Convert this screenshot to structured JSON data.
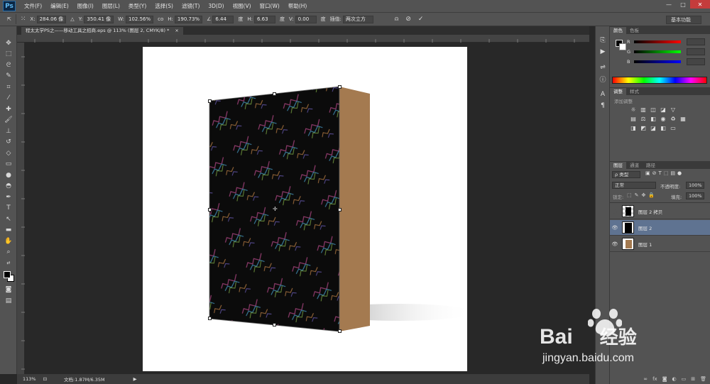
{
  "app": {
    "logo": "Ps"
  },
  "menu": [
    "文件(F)",
    "编辑(E)",
    "图像(I)",
    "图层(L)",
    "类型(Y)",
    "选择(S)",
    "滤镜(T)",
    "3D(D)",
    "视图(V)",
    "窗口(W)",
    "帮助(H)"
  ],
  "window_controls": {
    "minimize": "—",
    "maximize": "□",
    "close": "✕"
  },
  "options": {
    "x_label": "X:",
    "x_value": "284.06 像",
    "y_label": "Y:",
    "y_value": "350.41 像",
    "w_label": "W:",
    "w_value": "102.56%",
    "link_label": "co",
    "h_label": "H:",
    "h_value": "190.73%",
    "angle_value": "6.44",
    "angle_unit": "度",
    "hskew_label": "H:",
    "hskew_value": "6.63",
    "hskew_unit": "度",
    "vskew_label": "V:",
    "vskew_value": "0.00",
    "vskew_unit": "度",
    "interp_label": "插值:",
    "interp_value": "两次立方",
    "workspace": "基本功能"
  },
  "document": {
    "tab_title": "程太太学PS之——移动工具之招商.eps @ 113% (图层 2, CMYK/8) *"
  },
  "status": {
    "zoom": "113%",
    "doc_info": "文档:1.87M/6.35M"
  },
  "panels": {
    "color_tabs": [
      "颜色",
      "色板"
    ],
    "color_labels": [
      "R",
      "G",
      "B"
    ],
    "adjust_tabs": [
      "调整",
      "样式"
    ],
    "adjust_title": "添加调整",
    "layers_tabs": [
      "图层",
      "通道",
      "路径"
    ],
    "layer_filter": "ρ 类型",
    "blend_mode": "正常",
    "opacity_label": "不透明度:",
    "opacity_value": "100%",
    "lock_label": "锁定:",
    "fill_label": "填充:",
    "fill_value": "100%",
    "layers": [
      {
        "name": "图层 2 拷贝",
        "visible": false,
        "selected": false
      },
      {
        "name": "图层 2",
        "visible": true,
        "selected": true
      },
      {
        "name": "图层 1",
        "visible": true,
        "selected": false
      }
    ]
  },
  "watermark": {
    "brand": "Bai",
    "brand_suffix": "经验",
    "url": "jingyan.baidu.com"
  },
  "colors": {
    "selected_layer": "#5f7391",
    "box_side": "#a47a50",
    "box_front": "#0b0b0b"
  }
}
